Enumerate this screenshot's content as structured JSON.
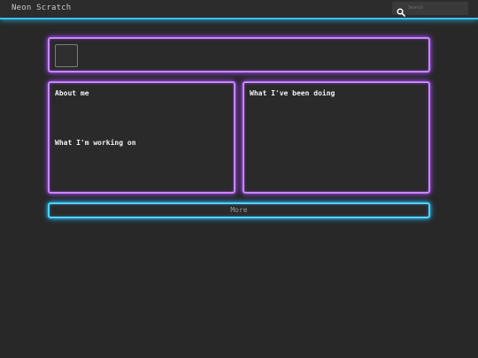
{
  "header": {
    "site_title": "Neon Scratch",
    "search": {
      "placeholder": "Search",
      "icon": "search-icon"
    }
  },
  "profile": {
    "avatar": "avatar-placeholder"
  },
  "left_panel": {
    "about_heading": "About me",
    "working_heading": "What I'm working on"
  },
  "right_panel": {
    "doing_heading": "What I've been doing"
  },
  "more_button": {
    "label": "More"
  },
  "colors": {
    "background": "#282828",
    "accent_blue": "#33c3ff",
    "accent_purple": "#c987ff",
    "text": "#f2f2f2"
  }
}
